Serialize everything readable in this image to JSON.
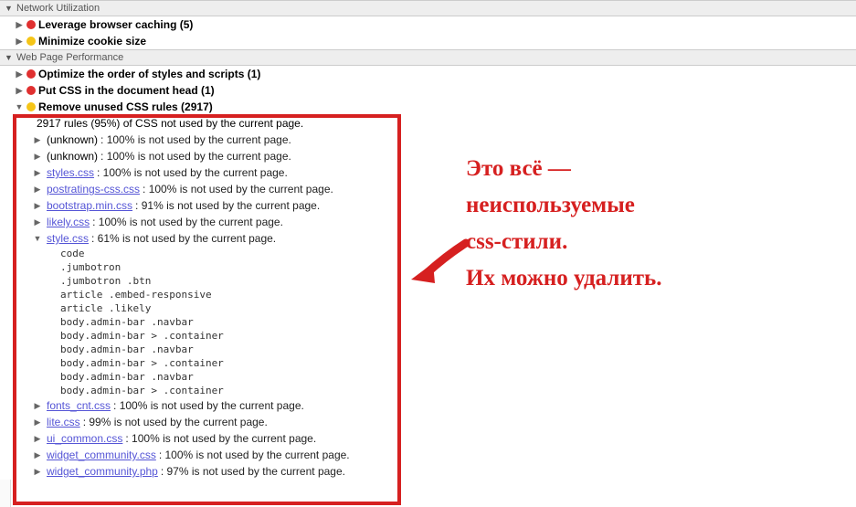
{
  "sections": {
    "network": {
      "title": "Network Utilization",
      "items": [
        {
          "severity": "red",
          "label": "Leverage browser caching (5)"
        },
        {
          "severity": "yellow",
          "label": "Minimize cookie size"
        }
      ]
    },
    "webpage": {
      "title": "Web Page Performance",
      "top_items": [
        {
          "severity": "red",
          "label": "Optimize the order of styles and scripts (1)"
        },
        {
          "severity": "red",
          "label": "Put CSS in the document head (1)"
        }
      ],
      "unused": {
        "severity": "yellow",
        "label": "Remove unused CSS rules (2917)",
        "summary": "2917 rules (95%) of CSS not used by the current page.",
        "files_before": [
          {
            "name": "(unknown)",
            "stat": ": 100% is not used by the current page.",
            "is_link": false
          },
          {
            "name": "(unknown)",
            "stat": ": 100% is not used by the current page.",
            "is_link": false
          },
          {
            "name": "styles.css",
            "stat": ": 100% is not used by the current page.",
            "is_link": true
          },
          {
            "name": "postratings-css.css",
            "stat": ": 100% is not used by the current page.",
            "is_link": true
          },
          {
            "name": "bootstrap.min.css",
            "stat": ": 91% is not used by the current page.",
            "is_link": true
          },
          {
            "name": "likely.css",
            "stat": ": 100% is not used by the current page.",
            "is_link": true
          }
        ],
        "expanded_file": {
          "name": "style.css",
          "stat": ": 61% is not used by the current page.",
          "rules": [
            "code",
            ".jumbotron",
            ".jumbotron .btn",
            "article .embed-responsive",
            "article .likely",
            "body.admin-bar .navbar",
            "body.admin-bar > .container",
            "body.admin-bar .navbar",
            "body.admin-bar > .container",
            "body.admin-bar .navbar",
            "body.admin-bar > .container"
          ]
        },
        "files_after": [
          {
            "name": "fonts_cnt.css",
            "stat": ": 100% is not used by the current page.",
            "is_link": true
          },
          {
            "name": "lite.css",
            "stat": ": 99% is not used by the current page.",
            "is_link": true
          },
          {
            "name": "ui_common.css",
            "stat": ": 100% is not used by the current page.",
            "is_link": true
          },
          {
            "name": "widget_community.css",
            "stat": ": 100% is not used by the current page.",
            "is_link": true
          },
          {
            "name": "widget_community.php",
            "stat": ": 97% is not used by the current page.",
            "is_link": true
          }
        ]
      }
    }
  },
  "annotation": {
    "line1": "Это всё —",
    "line2": "неиспользуемые",
    "line3": "css-стили.",
    "line4": "Их можно удалить."
  }
}
